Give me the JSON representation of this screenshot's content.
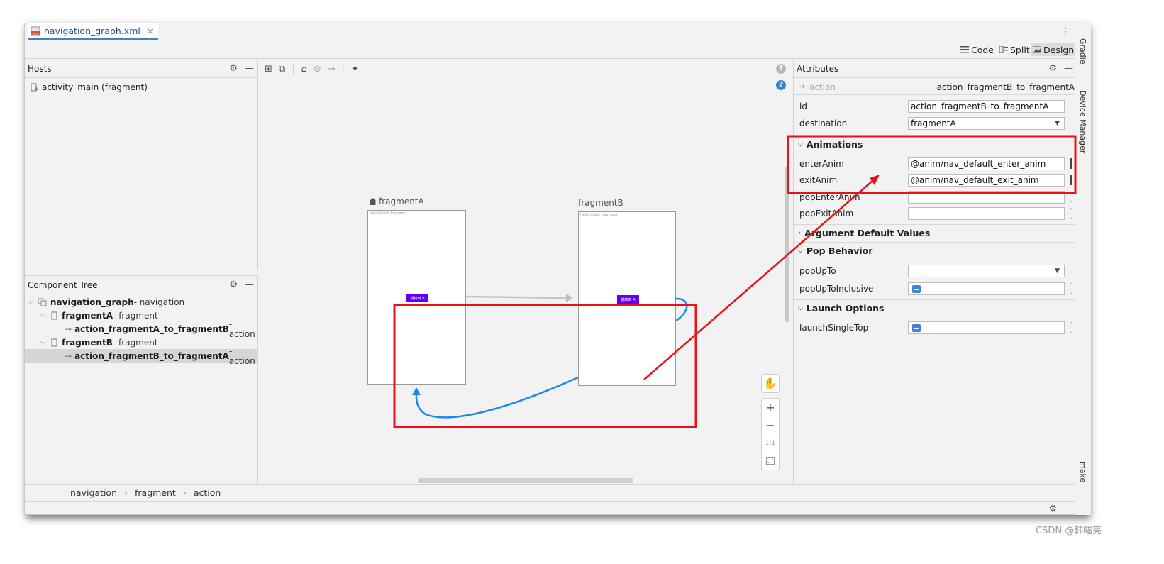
{
  "tab": {
    "title": "navigation_graph.xml",
    "close": "×"
  },
  "right_strip": {
    "gradle": "Gradle",
    "device_manager": "Device Manager",
    "make": "make"
  },
  "view_modes": {
    "code": "Code",
    "split": "Split",
    "design": "Design",
    "active": "Design"
  },
  "hosts": {
    "title": "Hosts",
    "items": [
      {
        "name": "activity_main",
        "type": "(fragment)"
      }
    ]
  },
  "component_tree": {
    "title": "Component Tree",
    "rows": [
      {
        "name": "navigation_graph",
        "suffix": " - navigation"
      },
      {
        "name": "fragmentA",
        "suffix": " - fragment"
      },
      {
        "name": "action_fragmentA_to_fragmentB",
        "suffix": " - action"
      },
      {
        "name": "fragmentB",
        "suffix": " - fragment"
      },
      {
        "name": "action_fragmentB_to_fragmentA",
        "suffix": " - action"
      }
    ],
    "selected_index": 4
  },
  "canvas": {
    "fragmentA": {
      "label": "fragmentA",
      "hint": "Hello blank fragment",
      "button": "跳转到 B"
    },
    "fragmentB": {
      "label": "fragmentB",
      "hint": "Hello blank fragment",
      "button": "跳转到 A"
    },
    "zoom": {
      "zoom_in": "+",
      "zoom_out": "−",
      "actual_size": "1:1"
    }
  },
  "attributes": {
    "title": "Attributes",
    "element_type": "action",
    "element_id": "action_fragmentB_to_fragmentA",
    "id_label": "id",
    "id_value": "action_fragmentB_to_fragmentA",
    "destination_label": "destination",
    "destination_value": "fragmentA",
    "sections": {
      "animations": "Animations",
      "argument_defaults": "Argument Default Values",
      "pop_behavior": "Pop Behavior",
      "launch_options": "Launch Options"
    },
    "enterAnim_label": "enterAnim",
    "enterAnim_value": "@anim/nav_default_enter_anim",
    "exitAnim_label": "exitAnim",
    "exitAnim_value": "@anim/nav_default_exit_anim",
    "popEnterAnim_label": "popEnterAnim",
    "popExitAnim_label": "popExitAnim",
    "popUpTo_label": "popUpTo",
    "popUpToInclusive_label": "popUpToInclusive",
    "launchSingleTop_label": "launchSingleTop"
  },
  "breadcrumb": {
    "items": [
      "navigation",
      "fragment",
      "action"
    ],
    "separator": "›"
  },
  "watermark": "CSDN @韩曙亮",
  "colors": {
    "accent": "#4083c9",
    "annotation_red": "#e8121a",
    "action_blue": "#1e88e5",
    "fragment_button": "#6200ee"
  }
}
